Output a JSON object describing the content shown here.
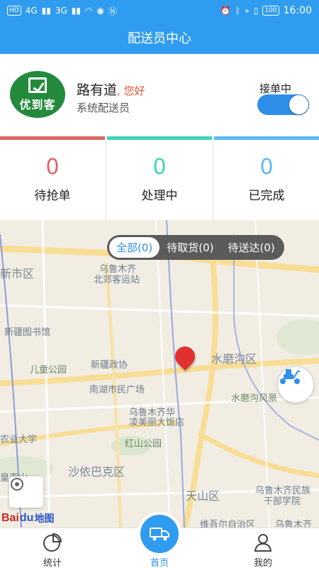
{
  "status_bar": {
    "left_pill": "HD",
    "net1": "4G",
    "net2": "3G",
    "battery": "100",
    "time": "16:00"
  },
  "header": {
    "title": "配送员中心"
  },
  "profile": {
    "logo_text": "优到客",
    "name": "路有道",
    "greeting": ", 您好",
    "role": "系统配送员",
    "toggle_label": "接单中",
    "toggle_on": true
  },
  "stats": [
    {
      "value": "0",
      "label": "待抢单",
      "color": "#e06565"
    },
    {
      "value": "0",
      "label": "处理中",
      "color": "#3dd6b8"
    },
    {
      "value": "0",
      "label": "已完成",
      "color": "#5cbcf0"
    }
  ],
  "filters": [
    {
      "label": "全部(0)",
      "active": true
    },
    {
      "label": "待取货(0)",
      "active": false
    },
    {
      "label": "待送达(0)",
      "active": false
    }
  ],
  "map_labels": [
    "新市区",
    "乌鲁木齐",
    "北郊客运站",
    "新疆图书馆",
    "儿童公园",
    "新疆政协",
    "水磨沟区",
    "南湖市民广场",
    "乌鲁木齐华",
    "凌美丽大饭店",
    "水磨沟风景",
    "农业大学",
    "红山公园",
    "沙依巴克区",
    "天山区",
    "乌鲁木齐民族",
    "干部学院",
    "皇克山",
    "维吾尔自治区",
    "乌鲁木齐"
  ],
  "map_logo": {
    "brand": "Bai",
    "paw": "du",
    "cn": "地图"
  },
  "tabbar": {
    "stats_label": "统计",
    "home_label": "首页",
    "mine_label": "我的"
  },
  "colors": {
    "primary": "#2f9cf0",
    "accent_blue": "#2f8fe8",
    "logo_green": "#238a3b",
    "pin_red": "#e23030"
  }
}
